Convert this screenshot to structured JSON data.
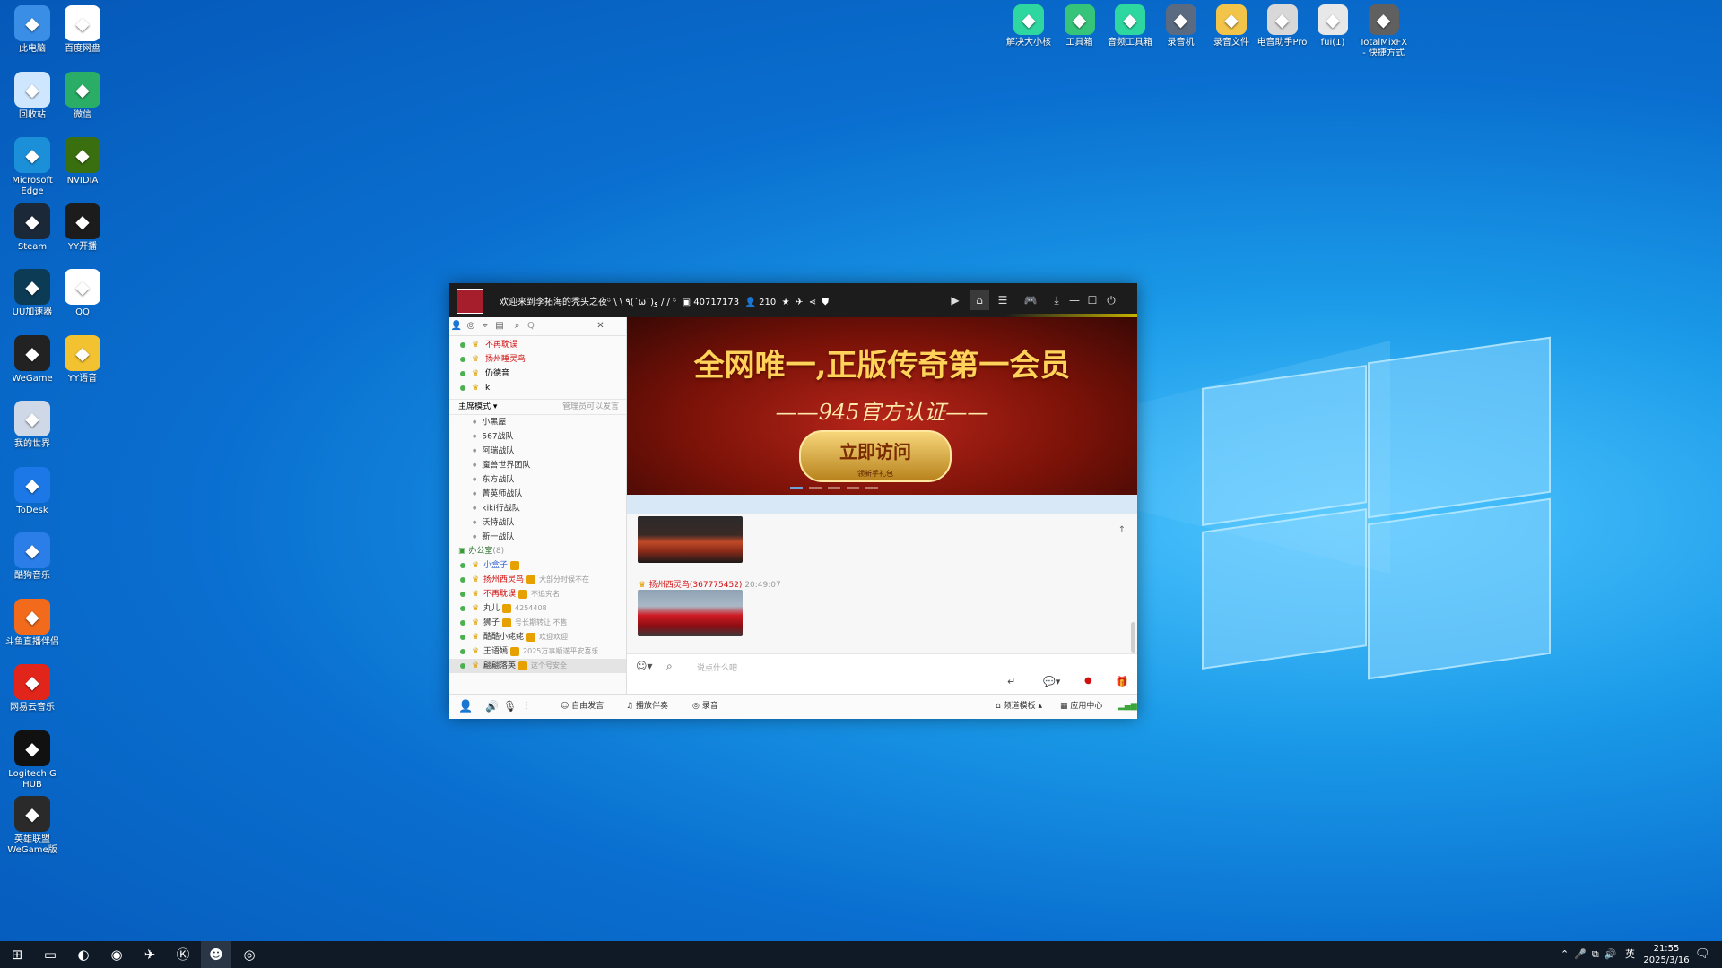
{
  "desktop_icons_left": [
    {
      "label": "此电脑",
      "icon": "computer-icon",
      "color": "#3a8ee6"
    },
    {
      "label": "百度网盘",
      "icon": "file-icon",
      "color": "#ffffff"
    },
    {
      "label": "回收站",
      "icon": "recycle-bin-icon",
      "color": "#cfe6ff"
    },
    {
      "label": "微信",
      "icon": "wechat-icon",
      "color": "#2aae67"
    },
    {
      "label": "Microsoft Edge",
      "icon": "edge-icon",
      "color": "#1b8fd8"
    },
    {
      "label": "NVIDIA",
      "icon": "nvidia-icon",
      "color": "#3a6f10"
    },
    {
      "label": "Steam",
      "icon": "steam-icon",
      "color": "#1b2838"
    },
    {
      "label": "YY开播",
      "icon": "yy-live-icon",
      "color": "#1c1c1c"
    },
    {
      "label": "UU加速器",
      "icon": "uu-icon",
      "color": "#0c3c55"
    },
    {
      "label": "QQ",
      "icon": "qq-icon",
      "color": "#ffffff"
    },
    {
      "label": "WeGame",
      "icon": "wegame-icon",
      "color": "#222222"
    },
    {
      "label": "YY语音",
      "icon": "yy-voice-icon",
      "color": "#f2c230"
    },
    {
      "label": "我的世界",
      "icon": "minecraft-icon",
      "color": "#cfd8e6"
    },
    {
      "label": "ToDesk",
      "icon": "todesk-icon",
      "color": "#1b78e6"
    },
    {
      "label": "酷狗音乐",
      "icon": "kugou-icon",
      "color": "#2b7de8"
    },
    {
      "label": "斗鱼直播伴侣",
      "icon": "douyu-icon",
      "color": "#f26a1b"
    },
    {
      "label": "网易云音乐",
      "icon": "netease-music-icon",
      "color": "#e1251b"
    },
    {
      "label": "Logitech G HUB",
      "icon": "logitech-icon",
      "color": "#111111"
    },
    {
      "label": "英雄联盟WeGame版",
      "icon": "lol-icon",
      "color": "#2a2a2a"
    }
  ],
  "desktop_icons_top": [
    {
      "label": "解决大小核",
      "icon": "gear-green-icon",
      "color": "#2ed6a0"
    },
    {
      "label": "工具箱",
      "icon": "toolbox-icon",
      "color": "#36c47a"
    },
    {
      "label": "音频工具箱",
      "icon": "audio-toolbox-icon",
      "color": "#2ed6a0"
    },
    {
      "label": "录音机",
      "icon": "recorder-icon",
      "color": "#5a6a80"
    },
    {
      "label": "录音文件",
      "icon": "folder-icon",
      "color": "#f2c44a"
    },
    {
      "label": "电音助手Pro",
      "icon": "disc-icon",
      "color": "#d8d8d8"
    },
    {
      "label": "fui(1)",
      "icon": "shortcut-icon",
      "color": "#e8e8e8"
    },
    {
      "label": "TotalMixFX - 快捷方式",
      "icon": "totalmix-icon",
      "color": "#606060"
    }
  ],
  "yy": {
    "title": "欢迎来到李拓海的秃头之夜ᵕ̈ \\ \\ ٩(ˊωˋ)و / / ᵕ̈",
    "channel_id": "40717173",
    "online_count": "210",
    "search_placeholder": "Q",
    "vip_users": [
      "不再耽误",
      "扬州睡灵鸟",
      "仍德音",
      "k"
    ],
    "mode_label": "主席模式",
    "mode_hint": "管理员可以发言",
    "sub_channels": [
      "小黑屋",
      "567战队",
      "阿瑞战队",
      "魔兽世界团队",
      "东方战队",
      "菁英师战队",
      "kiki行战队",
      "沃特战队",
      "新一战队"
    ],
    "office_label": "办公室",
    "office_count": "(8)",
    "members": [
      {
        "name": "小盒子",
        "note": "",
        "name_color": "#3060d0"
      },
      {
        "name": "扬州西灵鸟",
        "note": "大部分时候不在",
        "name_color": "#d01010"
      },
      {
        "name": "不再耽误",
        "note": "不追究名",
        "name_color": "#d01010"
      },
      {
        "name": "丸儿",
        "note": "4254408",
        "name_color": "#333333"
      },
      {
        "name": "狮子",
        "note": "号长期转让 不售",
        "name_color": "#333333"
      },
      {
        "name": "酷酷小姥姥",
        "note": "欢迎欢迎",
        "name_color": "#333333"
      },
      {
        "name": "王语嫣",
        "note": "2025万事顺遂平安喜乐",
        "name_color": "#333333"
      },
      {
        "name": "翩翩落英",
        "note": "这个号安全",
        "name_color": "#333333"
      }
    ],
    "banner": {
      "headline": "全网唯一,正版传奇第一会员",
      "subline": "——945官方认证——",
      "button": "立即访问",
      "button_sub": "领新手礼包"
    },
    "chat": {
      "sender": "扬州西灵鸟(367775452)",
      "time": "20:49:07"
    },
    "input_placeholder": "说点什么吧...",
    "bottom": {
      "free_speak": "自由发言",
      "play_music": "播放伴奏",
      "record": "录音",
      "channel_template": "频道模板",
      "app_center": "应用中心"
    }
  },
  "taskbar": {
    "apps": [
      "start-icon",
      "task-view-icon",
      "douyu-icon",
      "steam-icon",
      "flight-icon",
      "kugou-icon",
      "yy-voice-icon",
      "netease-music-icon"
    ],
    "ime": "英",
    "time": "21:55",
    "date": "2025/3/16"
  },
  "colors": {
    "desktop_blue": "#0a6fd0",
    "title_bar": "#1c1c1c",
    "highlight_red": "#d01010",
    "online_green": "#4caf50",
    "banner_gold": "#ffd35a"
  }
}
